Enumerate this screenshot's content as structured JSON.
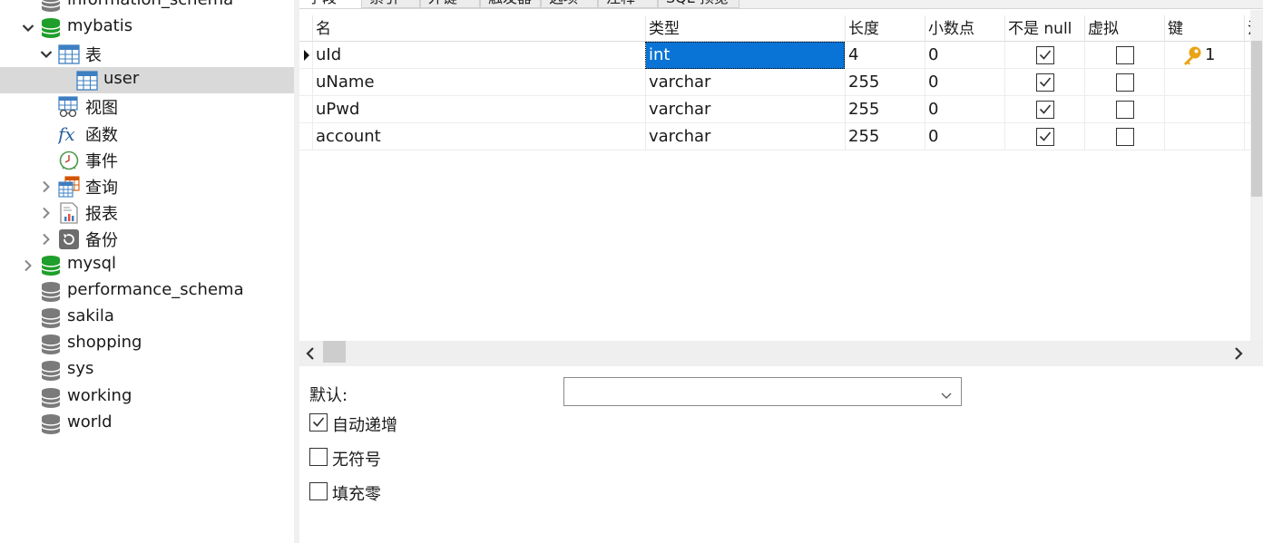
{
  "sidebar": {
    "items": [
      {
        "label": "information_schema",
        "icon": "database-gray-icon",
        "expandable": false,
        "expanded": false,
        "level": 0
      },
      {
        "label": "mybatis",
        "icon": "database-green-icon",
        "expandable": true,
        "expanded": true,
        "level": 0
      },
      {
        "label": "表",
        "icon": "table-group-icon",
        "expandable": true,
        "expanded": true,
        "level": 1
      },
      {
        "label": "user",
        "icon": "table-icon",
        "expandable": false,
        "expanded": false,
        "level": 2,
        "selected": true
      },
      {
        "label": "视图",
        "icon": "view-icon",
        "expandable": false,
        "expanded": false,
        "level": 1
      },
      {
        "label": "函数",
        "icon": "function-icon",
        "expandable": false,
        "expanded": false,
        "level": 1
      },
      {
        "label": "事件",
        "icon": "event-clock-icon",
        "expandable": false,
        "expanded": false,
        "level": 1
      },
      {
        "label": "查询",
        "icon": "query-icon",
        "expandable": true,
        "expanded": false,
        "level": 1
      },
      {
        "label": "报表",
        "icon": "report-icon",
        "expandable": true,
        "expanded": false,
        "level": 1
      },
      {
        "label": "备份",
        "icon": "backup-icon",
        "expandable": true,
        "expanded": false,
        "level": 1
      },
      {
        "label": "mysql",
        "icon": "database-green-icon",
        "expandable": true,
        "expanded": false,
        "level": 0
      },
      {
        "label": "performance_schema",
        "icon": "database-gray-icon",
        "expandable": false,
        "expanded": false,
        "level": 0
      },
      {
        "label": "sakila",
        "icon": "database-gray-icon",
        "expandable": false,
        "expanded": false,
        "level": 0
      },
      {
        "label": "shopping",
        "icon": "database-gray-icon",
        "expandable": false,
        "expanded": false,
        "level": 0
      },
      {
        "label": "sys",
        "icon": "database-gray-icon",
        "expandable": false,
        "expanded": false,
        "level": 0
      },
      {
        "label": "working",
        "icon": "database-gray-icon",
        "expandable": false,
        "expanded": false,
        "level": 0
      },
      {
        "label": "world",
        "icon": "database-gray-icon",
        "expandable": false,
        "expanded": false,
        "level": 0
      }
    ]
  },
  "tabs": [
    {
      "label": "字段",
      "active": true
    },
    {
      "label": "索引",
      "active": false
    },
    {
      "label": "外键",
      "active": false
    },
    {
      "label": "触发器",
      "active": false
    },
    {
      "label": "选项",
      "active": false
    },
    {
      "label": "注释",
      "active": false
    },
    {
      "label": "SQL 预览",
      "active": false
    }
  ],
  "grid": {
    "columns": [
      {
        "label": "名"
      },
      {
        "label": "类型"
      },
      {
        "label": "长度"
      },
      {
        "label": "小数点"
      },
      {
        "label": "不是 null"
      },
      {
        "label": "虚拟"
      },
      {
        "label": "键"
      },
      {
        "label": "注"
      }
    ],
    "rows": [
      {
        "name": "uId",
        "type": "int",
        "length": "4",
        "decimals": "0",
        "not_null": true,
        "virtual": false,
        "key": "1",
        "is_key": true,
        "current": true
      },
      {
        "name": "uName",
        "type": "varchar",
        "length": "255",
        "decimals": "0",
        "not_null": true,
        "virtual": false,
        "key": "",
        "is_key": false,
        "current": false
      },
      {
        "name": "uPwd",
        "type": "varchar",
        "length": "255",
        "decimals": "0",
        "not_null": true,
        "virtual": false,
        "key": "",
        "is_key": false,
        "current": false
      },
      {
        "name": "account",
        "type": "varchar",
        "length": "255",
        "decimals": "0",
        "not_null": true,
        "virtual": false,
        "key": "",
        "is_key": false,
        "current": false
      }
    ],
    "selected_cell": {
      "row": 0,
      "column": "type"
    }
  },
  "properties": {
    "default_label": "默认:",
    "default_value": "",
    "auto_increment": {
      "label": "自动递增",
      "checked": true
    },
    "unsigned": {
      "label": "无符号",
      "checked": false
    },
    "zerofill": {
      "label": "填充零",
      "checked": false
    }
  },
  "colors": {
    "selection_blue": "#0a74d6",
    "tree_selected": "#d9d9d9",
    "db_green": "#1e9e2a",
    "db_gray": "#7a7a7a",
    "key_gold": "#e8a317"
  }
}
